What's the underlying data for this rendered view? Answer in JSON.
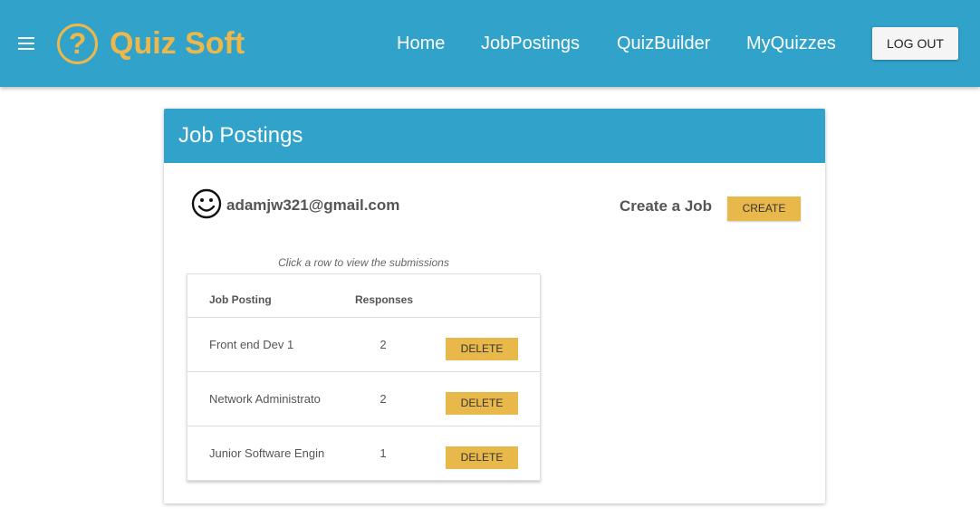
{
  "header": {
    "brand": "Quiz Soft",
    "logo_glyph": "?",
    "nav": [
      "Home",
      "JobPostings",
      "QuizBuilder",
      "MyQuizzes"
    ],
    "logout_label": "LOG OUT",
    "menu_icon": "hamburger-icon",
    "colors": {
      "bar": "#31a3cb",
      "brand": "#eeb74a"
    }
  },
  "page": {
    "title": "Job Postings",
    "user": {
      "icon": "smiley-icon",
      "email": "adamjw321@gmail.com"
    },
    "create_label": "Create a Job",
    "create_button": "CREATE",
    "hint": "Click a row to view the submissions",
    "table": {
      "columns": [
        "Job Posting",
        "Responses"
      ],
      "rows": [
        {
          "name": "Front end Dev 1",
          "responses": "2",
          "delete": "DELETE"
        },
        {
          "name": "Network Administrato",
          "responses": "2",
          "delete": "DELETE"
        },
        {
          "name": "Junior Software Engin",
          "responses": "1",
          "delete": "DELETE"
        }
      ]
    },
    "colors": {
      "button": "#e9b84a"
    }
  }
}
